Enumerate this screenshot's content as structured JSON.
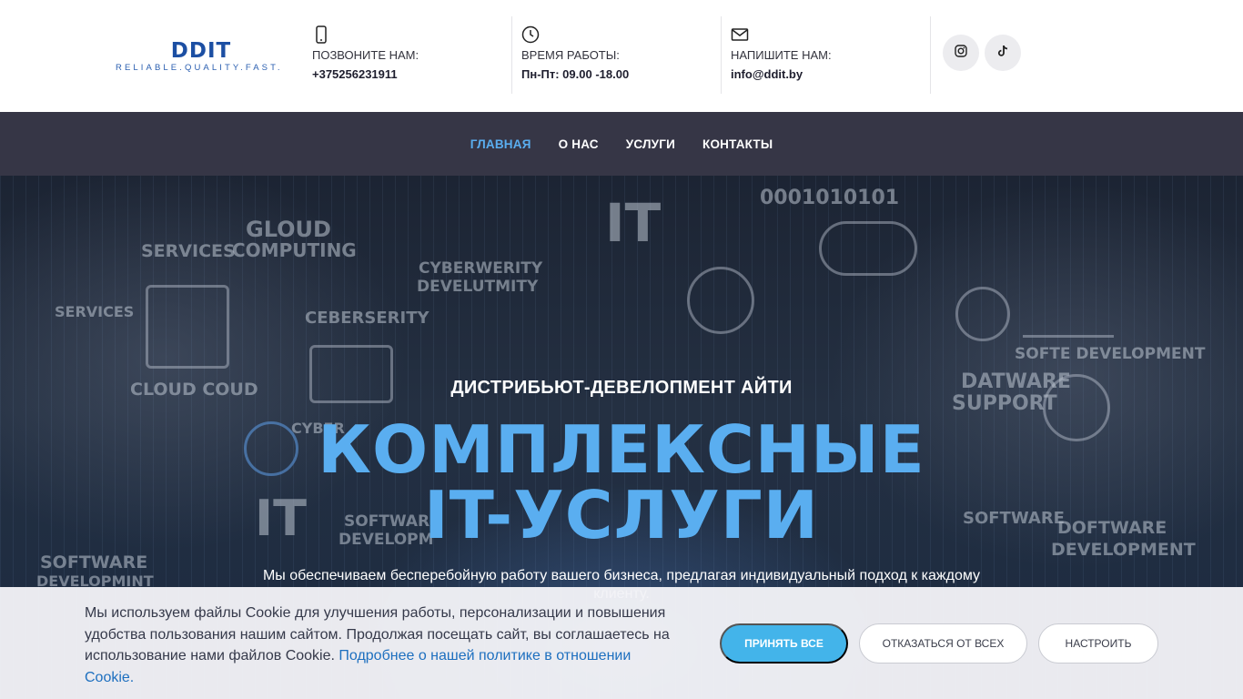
{
  "logo": {
    "main": "DDIT",
    "tagline": "RELIABLE.QUALITY.FAST."
  },
  "contacts": [
    {
      "icon": "phone-icon",
      "label": "ПОЗВОНИТЕ НАМ:",
      "value": "+375256231911"
    },
    {
      "icon": "clock-icon",
      "label": "ВРЕМЯ РАБОТЫ:",
      "value": "Пн-Пт: 09.00 -18.00"
    },
    {
      "icon": "mail-icon",
      "label": "НАПИШИТЕ НАМ:",
      "value": "info@ddit.by"
    }
  ],
  "social": [
    {
      "icon": "instagram-icon"
    },
    {
      "icon": "tiktok-icon"
    }
  ],
  "nav": {
    "items": [
      {
        "label": "ГЛАВНАЯ",
        "active": true
      },
      {
        "label": "О НАС",
        "active": false
      },
      {
        "label": "УСЛУГИ",
        "active": false
      },
      {
        "label": "КОНТАКТЫ",
        "active": false
      }
    ]
  },
  "hero": {
    "subtitle": "ДИСТРИБЬЮТ-ДЕВЕЛОПМЕНТ АЙТИ",
    "title_line1": "КОМПЛЕКСНЫЕ",
    "title_line2": "IT-УСЛУГИ",
    "description": "Мы обеспечиваем бесперебойную работу вашего бизнеса, предлагая индивидуальный подход к каждому клиенту.",
    "background_words": [
      "GLOUD",
      "COMPUTING",
      "SERVICES",
      "CYBERWERITY",
      "DEVELUTMITY",
      "CEBERSERITY",
      "CLOUD COUD",
      "IT",
      "0001010101",
      "DATWARE",
      "SUPPORT",
      "SOFTE DEVELOPMENT",
      "SOFTWARE",
      "DOFTWARE",
      "DEVELOPMENT",
      "SOFTWARE",
      "DEVELOPMINT",
      "SOFTWARE",
      "DEVELOPM",
      "CYBER",
      "SERVICES",
      "IT"
    ]
  },
  "cookie": {
    "text": "Мы используем файлы Cookie для улучшения работы, персонализации и повышения удобства пользования нашим сайтом. Продолжая посещать сайт, вы соглашаетесь на использование нами файлов Cookie. ",
    "link": "Подробнее о нашей политике в отношении Cookie.",
    "accept": "ПРИНЯТЬ ВСЕ",
    "reject": "ОТКАЗАТЬСЯ ОТ ВСЕХ",
    "configure": "НАСТРОИТЬ"
  },
  "colors": {
    "accent": "#5aaef0",
    "nav_bg": "#363646",
    "button": "#43b4ea",
    "logo": "#1c4fa3"
  }
}
